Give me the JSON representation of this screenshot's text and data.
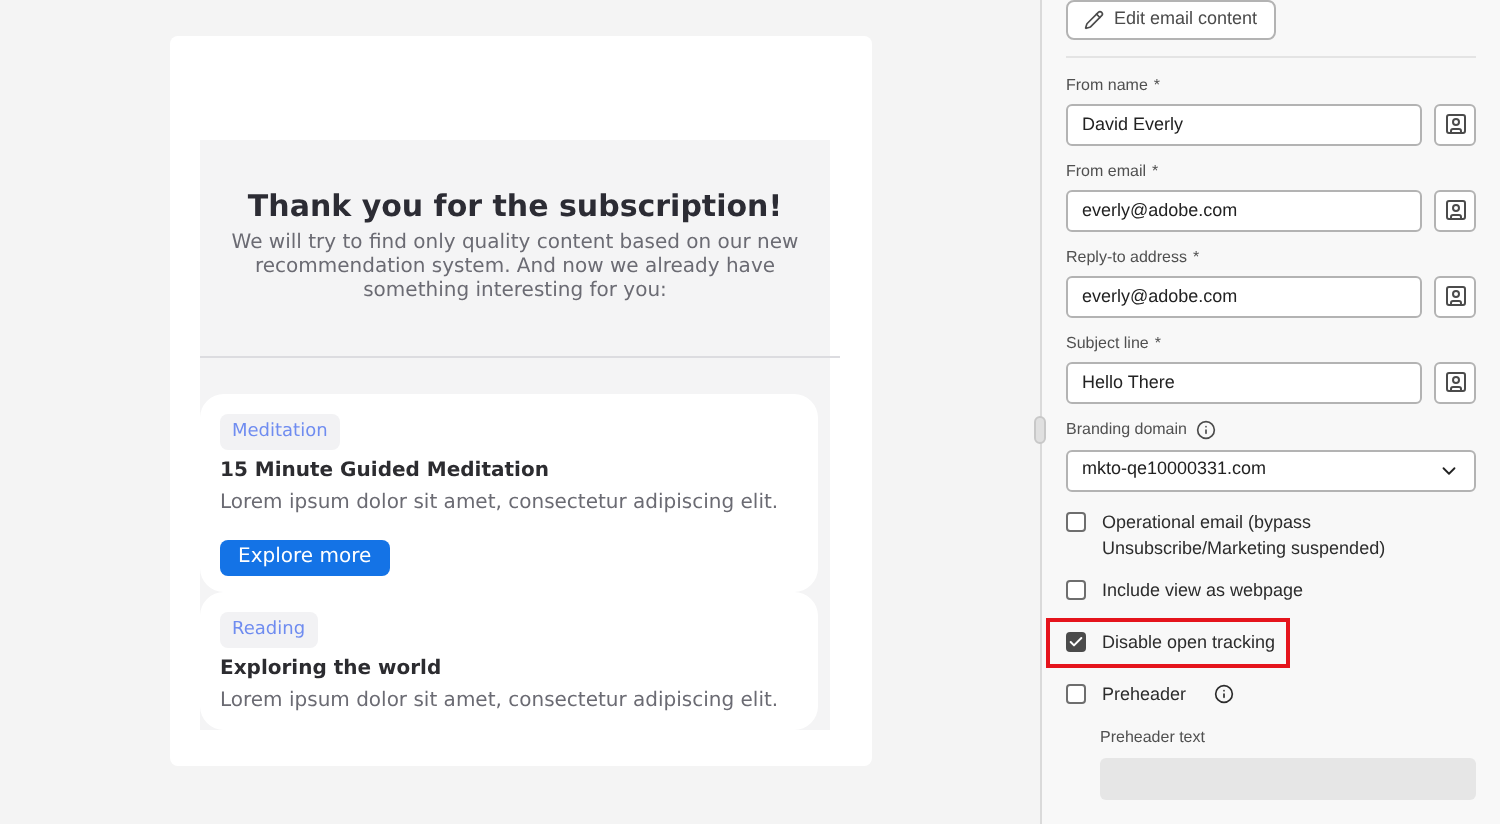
{
  "email_preview": {
    "heading": "Thank you for the subscription!",
    "intro": "We will try to find only quality content based on our new recommendation system. And now we already have something interesting for you:",
    "cards": [
      {
        "tag": "Meditation",
        "title": "15 Minute Guided Meditation",
        "body": "Lorem ipsum dolor sit amet, consectetur adipiscing elit.",
        "button": "Explore more"
      },
      {
        "tag": "Reading",
        "title": "Exploring the world",
        "body": "Lorem ipsum dolor sit amet, consectetur adipiscing elit."
      }
    ]
  },
  "panel": {
    "edit_button": "Edit email content",
    "fields": [
      {
        "label": "From name",
        "required_mark": "*",
        "value": "David Everly"
      },
      {
        "label": "From email",
        "required_mark": "*",
        "value": "everly@adobe.com"
      },
      {
        "label": "Reply-to address",
        "required_mark": "*",
        "value": "everly@adobe.com"
      },
      {
        "label": "Subject line",
        "required_mark": "*",
        "value": "Hello There"
      }
    ],
    "branding": {
      "label": "Branding domain",
      "value": "mkto-qe10000331.com"
    },
    "options": [
      {
        "kind": "plain",
        "label": "Operational email (bypass Unsubscribe/Marketing suspended)",
        "checked": false,
        "highlighted": false
      },
      {
        "kind": "plain",
        "label": "Include view as webpage",
        "checked": false,
        "highlighted": false
      },
      {
        "kind": "plain",
        "label": "Disable open tracking",
        "checked": true,
        "highlighted": true
      },
      {
        "kind": "info",
        "label": "Preheader",
        "checked": false,
        "highlighted": false
      }
    ],
    "preheader_text": {
      "label": "Preheader text",
      "disabled": true
    }
  }
}
